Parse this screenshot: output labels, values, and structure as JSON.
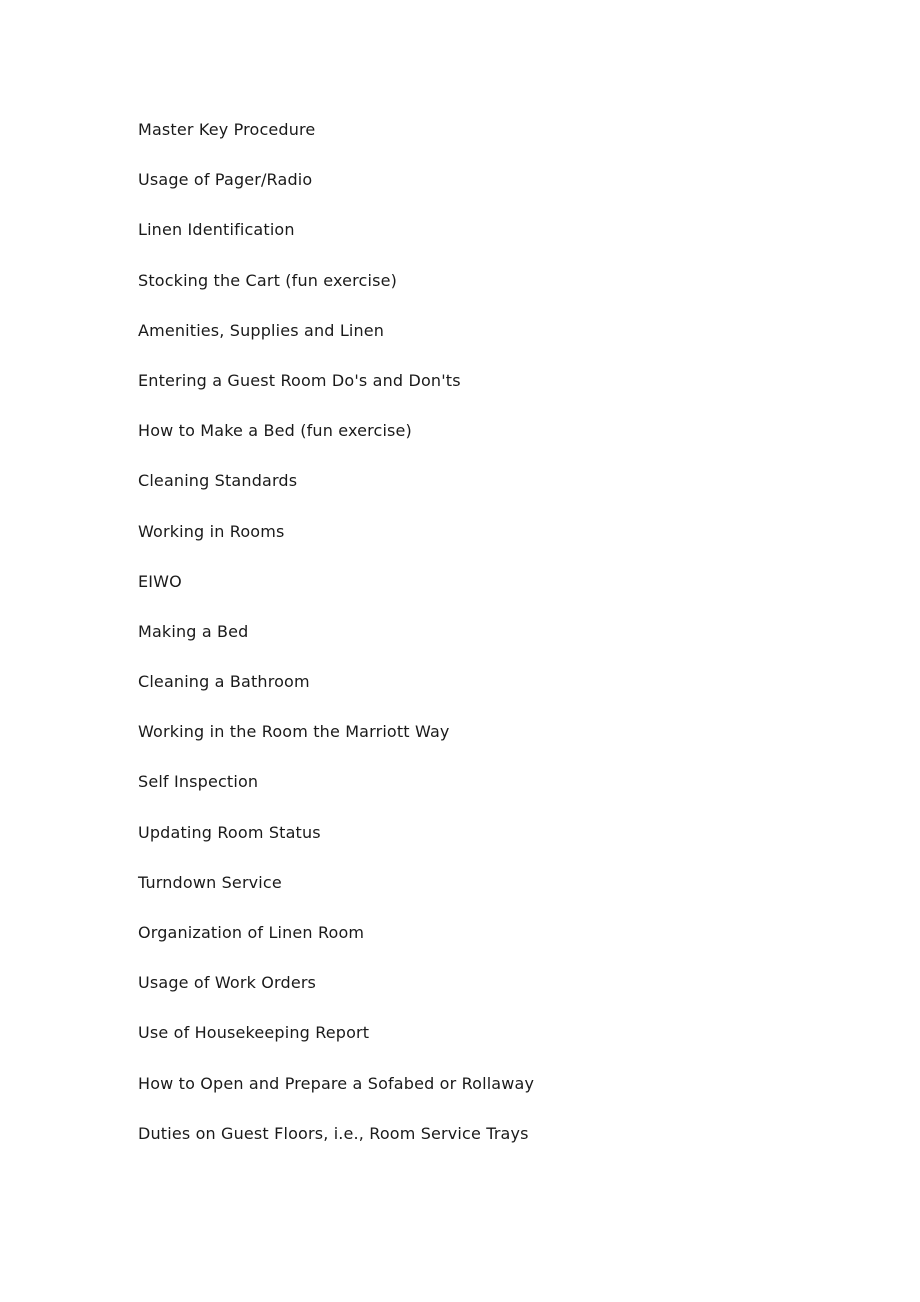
{
  "document": {
    "page_background": "#ffffff",
    "text_color": "#1a1a1a",
    "lines": [
      {
        "text": "Master Key Procedure"
      },
      {
        "text": "Usage of Pager/Radio"
      },
      {
        "text": "Linen Identification"
      },
      {
        "text": "Stocking the Cart (fun exercise)"
      },
      {
        "text": "Amenities, Supplies and Linen"
      },
      {
        "text": "Entering a Guest Room Do's and Don'ts"
      },
      {
        "text": "How to Make a Bed (fun exercise)"
      },
      {
        "text": "Cleaning Standards"
      },
      {
        "text": "Working in Rooms"
      },
      {
        "text": "EIWO"
      },
      {
        "text": "Making a Bed"
      },
      {
        "text": "Cleaning a Bathroom"
      },
      {
        "text": "Working in the Room the Marriott Way"
      },
      {
        "text": "Self Inspection"
      },
      {
        "text": "Updating Room Status"
      },
      {
        "text": "Turndown Service"
      },
      {
        "text": "Organization of Linen Room"
      },
      {
        "text": "Usage of Work Orders"
      },
      {
        "text": "Use of Housekeeping Report"
      },
      {
        "text": "How to Open and Prepare a Sofabed or Rollaway"
      },
      {
        "text": "Duties on Guest Floors, i.e., Room Service Trays"
      }
    ]
  }
}
